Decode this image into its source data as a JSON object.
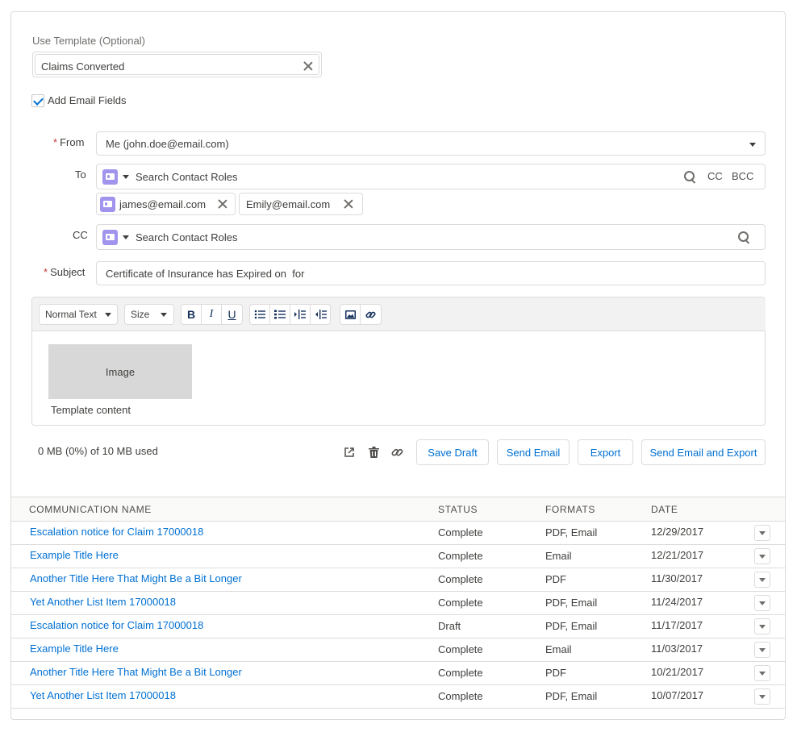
{
  "template": {
    "label": "Use Template (Optional)",
    "value": "Claims Converted"
  },
  "add_email_fields": {
    "label": "Add Email Fields",
    "checked": true
  },
  "from": {
    "label": "From",
    "value": "Me (john.doe@email.com)"
  },
  "to": {
    "label": "To",
    "placeholder": "Search Contact Roles",
    "cc_link": "CC",
    "bcc_link": "BCC",
    "recipients": [
      "james@email.com",
      "Emily@email.com"
    ]
  },
  "cc": {
    "label": "CC",
    "placeholder": "Search Contact Roles"
  },
  "subject": {
    "label": "Subject",
    "value": "Certificate of Insurance has Expired on  for"
  },
  "toolbar": {
    "format": "Normal Text",
    "size": "Size",
    "bold": "B",
    "italic": "I",
    "underline": "U"
  },
  "editor": {
    "image_placeholder": "Image",
    "content": "Template content"
  },
  "footer": {
    "usage": "0 MB (0%) of 10 MB used",
    "save_draft": "Save Draft",
    "send_email": "Send Email",
    "export": "Export",
    "send_and_export": "Send Email and Export"
  },
  "table": {
    "headers": [
      "COMMUNICATION NAME",
      "STATUS",
      "FORMATS",
      "DATE"
    ],
    "rows": [
      {
        "name": "Escalation notice for Claim 17000018",
        "status": "Complete",
        "formats": "PDF, Email",
        "date": "12/29/2017"
      },
      {
        "name": "Example Title Here",
        "status": "Complete",
        "formats": "Email",
        "date": "12/21/2017"
      },
      {
        "name": "Another Title Here That Might Be a Bit Longer",
        "status": "Complete",
        "formats": "PDF",
        "date": "11/30/2017"
      },
      {
        "name": "Yet Another List Item 17000018",
        "status": "Complete",
        "formats": "PDF, Email",
        "date": "11/24/2017"
      },
      {
        "name": "Escalation notice for Claim 17000018",
        "status": "Draft",
        "formats": "PDF, Email",
        "date": "11/17/2017"
      },
      {
        "name": "Example Title Here",
        "status": "Complete",
        "formats": "Email",
        "date": "11/03/2017"
      },
      {
        "name": "Another Title Here That Might Be a Bit Longer",
        "status": "Complete",
        "formats": "PDF",
        "date": "10/21/2017"
      },
      {
        "name": "Yet Another List Item 17000018",
        "status": "Complete",
        "formats": "PDF, Email",
        "date": "10/07/2017"
      }
    ]
  },
  "colors": {
    "link": "#0070d2",
    "required": "#c23934",
    "contact_icon": "#a094ed",
    "border": "#dddbda"
  }
}
